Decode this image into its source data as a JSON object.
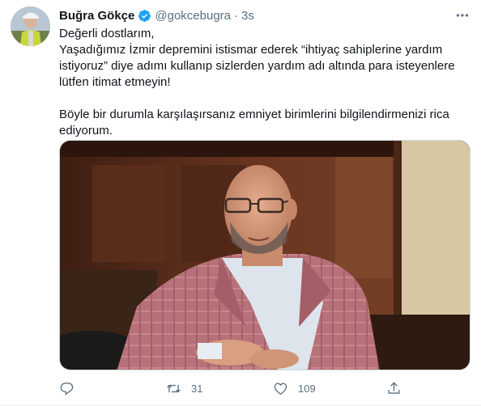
{
  "tweet": {
    "author_name": "Buğra Gökçe",
    "handle": "@gokcebugra",
    "separator": "·",
    "timestamp": "3s",
    "text_lines": [
      "Değerli dostlarım,",
      "Yaşadığımız İzmir depremini istismar ederek “ihtiyaç sahiplerine yardım",
      "istiyoruz” diye adımı kullanıp sizlerden yardım adı altında para isteyenlere",
      "lütfen itimat etmeyin!",
      "Böyle bir durumla karşılaşırsanız emniyet birimlerini bilgilendirmenizi rica",
      "ediyorum."
    ]
  },
  "actions": {
    "reply_count": "",
    "retweet_count": "31",
    "like_count": "109",
    "share_count": ""
  },
  "icons": {
    "verified": "verified-badge-icon",
    "more": "more-options-icon",
    "reply": "reply-icon",
    "retweet": "retweet-icon",
    "like": "heart-icon",
    "share": "share-icon"
  },
  "colors": {
    "accent": "#1da1f2",
    "text": "#0f1419",
    "secondary": "#5b7083"
  }
}
